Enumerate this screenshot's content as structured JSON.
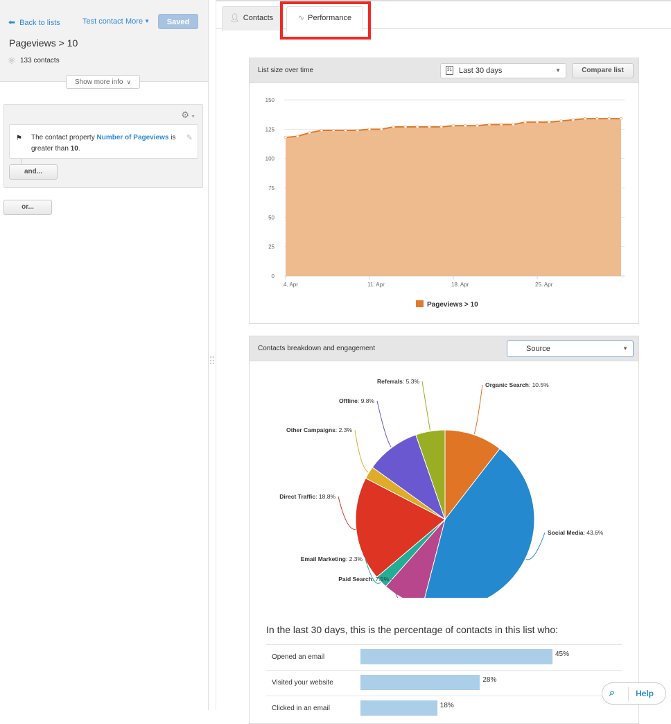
{
  "sidebar": {
    "back_label": "Back to lists",
    "test_contact_label": "Test contact",
    "more_label": "More",
    "saved_label": "Saved",
    "list_title": "Pageviews > 10",
    "contact_count": "133 contacts",
    "show_more_label": "Show more info",
    "filter": {
      "prefix": "The contact property",
      "property": "Number of Pageviews",
      "middle": "is greater than",
      "value": "10",
      "suffix": "."
    },
    "and_label": "and...",
    "or_label": "or..."
  },
  "tabs": [
    {
      "label": "Contacts",
      "icon": "person-icon",
      "active": false
    },
    {
      "label": "Performance",
      "icon": "pulse-icon",
      "active": true
    }
  ],
  "list_size_panel": {
    "title": "List size over time",
    "date_range": "Last 30 days",
    "date_icon_text": "31",
    "compare_label": "Compare list"
  },
  "breakdown_panel": {
    "title": "Contacts breakdown and engagement",
    "breakdown_by": "Source"
  },
  "engagement": {
    "title": "In the last 30 days, this is the percentage of contacts in this list who:",
    "rows": [
      {
        "label": "Opened an email",
        "value": 45,
        "display": "45%"
      },
      {
        "label": "Visited your website",
        "value": 28,
        "display": "28%"
      },
      {
        "label": "Clicked in an email",
        "value": 18,
        "display": "18%"
      }
    ]
  },
  "help": {
    "label": "Help"
  },
  "colors": {
    "accent": "#2e8ad8",
    "area_fill": "#eebb8f",
    "area_line": "#e07a2c",
    "highlight": "#ee2a24"
  },
  "chart_data": [
    {
      "type": "area",
      "title": "List size over time",
      "xlabel": "",
      "ylabel": "",
      "ylim": [
        0,
        150
      ],
      "yticks": [
        0,
        25,
        50,
        75,
        100,
        125,
        150
      ],
      "xtick_labels": [
        "4. Apr",
        "11. Apr",
        "18. Apr",
        "25. Apr"
      ],
      "xtick_index": [
        1,
        8,
        15,
        22
      ],
      "grid": true,
      "legend": "bottom-center",
      "series": [
        {
          "name": "Pageviews > 10",
          "color": "#e07a2c",
          "values": [
            118,
            119,
            122,
            124,
            124,
            124,
            124,
            125,
            125,
            127,
            127,
            127,
            127,
            127,
            128,
            128,
            128,
            129,
            129,
            129,
            131,
            131,
            131,
            132,
            133,
            134,
            134,
            134,
            134
          ]
        }
      ]
    },
    {
      "type": "pie",
      "title": "Contacts breakdown by Source",
      "slices": [
        {
          "label": "Organic Search",
          "value": 10.5,
          "color": "#e07526"
        },
        {
          "label": "Social Media",
          "value": 43.6,
          "color": "#2489cf"
        },
        {
          "label": "Paid Search",
          "value": 7.5,
          "color": "#b8468c"
        },
        {
          "label": "Email Marketing",
          "value": 2.3,
          "color": "#24ac95"
        },
        {
          "label": "Direct Traffic",
          "value": 18.8,
          "color": "#dd3424"
        },
        {
          "label": "Other Campaigns",
          "value": 2.3,
          "color": "#dfac29"
        },
        {
          "label": "Offline",
          "value": 9.8,
          "color": "#6958d0"
        },
        {
          "label": "Referrals",
          "value": 5.3,
          "color": "#9aae24"
        }
      ]
    },
    {
      "type": "bar",
      "title": "In the last 30 days, this is the percentage of contacts in this list who:",
      "categories": [
        "Opened an email",
        "Visited your website",
        "Clicked in an email"
      ],
      "values": [
        45,
        28,
        18
      ],
      "unit": "%"
    }
  ]
}
